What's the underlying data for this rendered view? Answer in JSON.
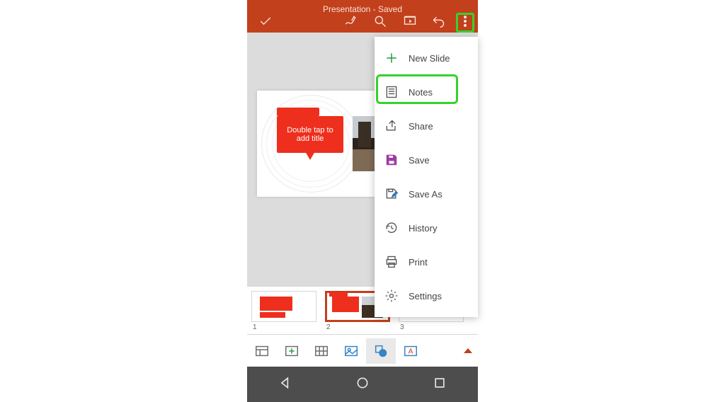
{
  "header": {
    "title": "Presentation - Saved"
  },
  "slide": {
    "placeholder": "Double tap to add title"
  },
  "thumbs": [
    {
      "n": "1"
    },
    {
      "n": "2"
    },
    {
      "n": "3"
    }
  ],
  "menu": {
    "new_slide": "New Slide",
    "notes": "Notes",
    "share": "Share",
    "save": "Save",
    "save_as": "Save As",
    "history": "History",
    "print": "Print",
    "settings": "Settings"
  }
}
